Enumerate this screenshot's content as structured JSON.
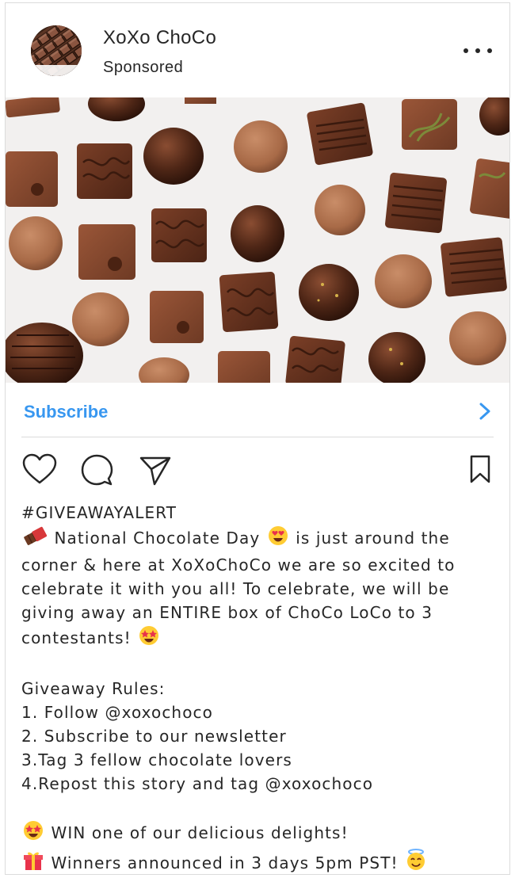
{
  "account": {
    "name": "XoXo ChoCo",
    "label": "Sponsored"
  },
  "post": {
    "image": "chocolate-assortment-photo",
    "cta": "Subscribe"
  },
  "icons": {
    "like": "heart-icon",
    "comment": "comment-icon",
    "share": "send-icon",
    "save": "bookmark-icon",
    "more": "more-options-icon",
    "cta": "chevron-right-icon"
  },
  "colors": {
    "accent": "#3897f0",
    "text": "#262626",
    "divider": "#dbdbdb"
  },
  "caption": {
    "hashtag": "#GIVEAWAYALERT",
    "p1_a": "National Chocolate Day",
    "p1_b": "is just around the",
    "p1_c": "corner & here at XoXoChoCo we are so excited to",
    "p1_d": "celebrate it with you all! To celebrate, we will be",
    "p1_e": "giving away an ENTIRE box of ChoCo LoCo to 3",
    "p1_f": "contestants!",
    "rules_title": "Giveaway Rules:",
    "rules": [
      "1. Follow @xoxochoco",
      "2. Subscribe to our newsletter",
      "3.Tag 3 fellow chocolate lovers",
      "4.Repost this story and tag @xoxochoco"
    ],
    "win": "WIN one of our delicious delights!",
    "winners": "Winners announced in 3 days 5pm PST!"
  }
}
